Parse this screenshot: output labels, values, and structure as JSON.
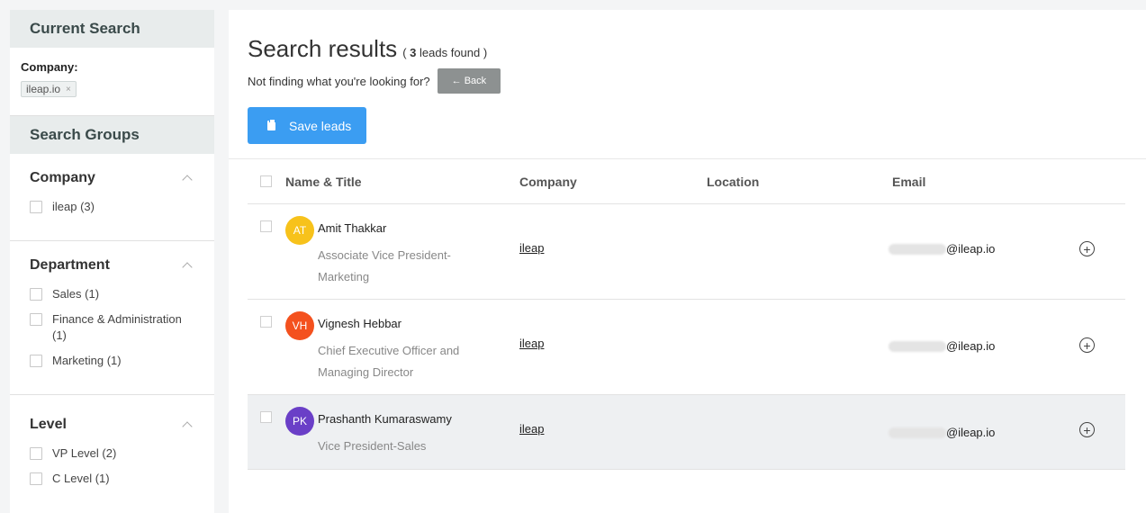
{
  "sidebar": {
    "current_search_title": "Current Search",
    "company_label": "Company:",
    "company_tag": "ileap.io",
    "tag_remove": "×",
    "search_groups_title": "Search Groups",
    "groups": [
      {
        "title": "Company",
        "options": [
          {
            "label": "ileap (3)"
          }
        ]
      },
      {
        "title": "Department",
        "options": [
          {
            "label": "Sales (1)"
          },
          {
            "label": "Finance & Administration (1)"
          },
          {
            "label": "Marketing (1)"
          }
        ]
      },
      {
        "title": "Level",
        "options": [
          {
            "label": "VP Level (2)"
          },
          {
            "label": "C Level (1)"
          }
        ]
      }
    ]
  },
  "main": {
    "title": "Search results",
    "count_prefix": "(",
    "count": "3",
    "count_suffix": "leads found )",
    "not_finding": "Not finding what you're looking for?",
    "back_label": "← Back",
    "save_label": "Save leads",
    "columns": [
      "Name & Title",
      "Company",
      "Location",
      "Email"
    ],
    "rows": [
      {
        "initials": "AT",
        "avatar_color": "#f7c21b",
        "name": "Amit Thakkar",
        "title": "Associate Vice President-Marketing",
        "company": "ileap",
        "location": "",
        "email_domain": "@ileap.io"
      },
      {
        "initials": "VH",
        "avatar_color": "#f4511e",
        "name": "Vignesh Hebbar",
        "title": "Chief Executive Officer and Managing Director",
        "company": "ileap",
        "location": "",
        "email_domain": "@ileap.io"
      },
      {
        "initials": "PK",
        "avatar_color": "#6a3fc7",
        "name": "Prashanth Kumaraswamy",
        "title": "Vice President-Sales",
        "company": "ileap",
        "location": "",
        "email_domain": "@ileap.io"
      }
    ],
    "add_icon": "+"
  }
}
